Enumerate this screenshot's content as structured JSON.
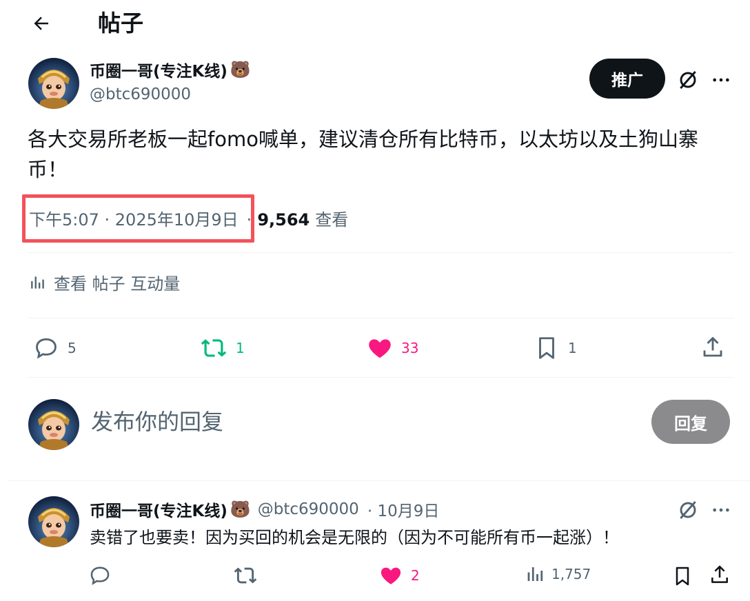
{
  "header": {
    "title": "帖子"
  },
  "post": {
    "display_name": "币圈一哥(专注K线)",
    "name_emoji": "🐻",
    "handle": "@btc690000",
    "promote_label": "推广",
    "text": "各大交易所老板一起fomo喊单，建议清仓所有比特币，以太坊以及土狗山寨币！",
    "time": "下午5:07 · 2025年10月9日",
    "separator": "·",
    "views_count": "9,564",
    "views_label": "查看",
    "engagements_label": "查看 帖子 互动量",
    "actions": {
      "replies": "5",
      "reposts": "1",
      "likes": "33",
      "bookmarks": "1"
    }
  },
  "compose": {
    "placeholder": "发布你的回复",
    "reply_label": "回复"
  },
  "reply": {
    "display_name": "币圈一哥(专注K线)",
    "name_emoji": "🐻",
    "handle": "@btc690000",
    "date": "· 10月9日",
    "text": "卖错了也要卖！因为买回的机会是无限的（因为不可能所有币一起涨）！",
    "actions": {
      "replies": "",
      "reposts": "",
      "likes": "2",
      "views": "1,757"
    }
  },
  "colors": {
    "accent_like": "#f91880",
    "accent_repost": "#00ba7c",
    "highlight_box": "#f2525a",
    "muted": "#536471"
  }
}
